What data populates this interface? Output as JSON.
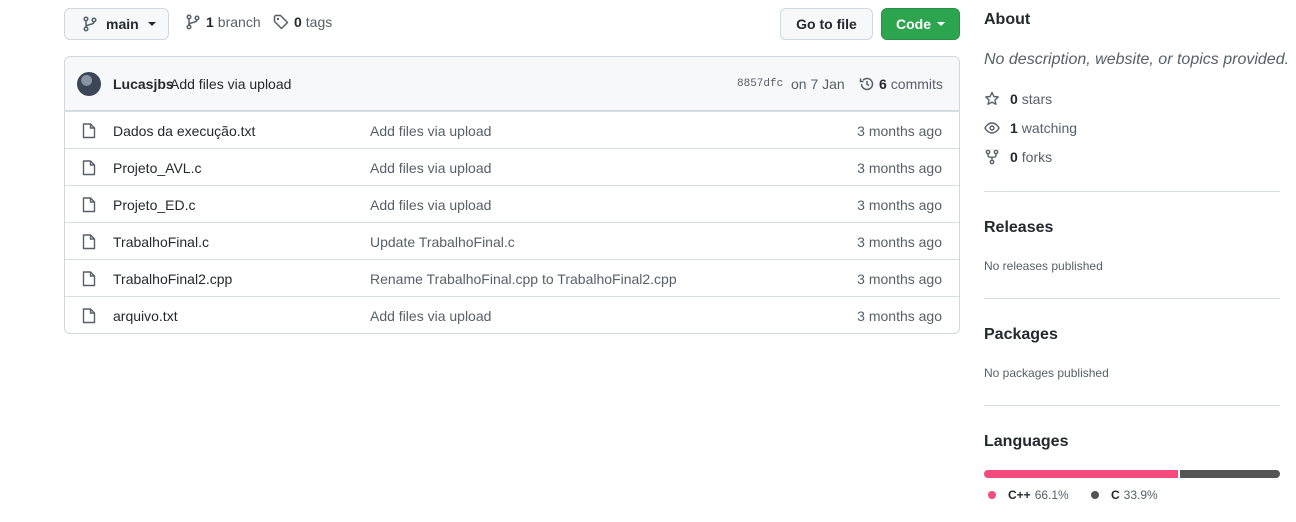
{
  "toolbar": {
    "branch_selector": "main",
    "branches_count": "1",
    "branches_label": "branch",
    "tags_count": "0",
    "tags_label": "tags",
    "go_to_file": "Go to file",
    "code_button": "Code"
  },
  "latest_commit": {
    "author": "Lucasjbs",
    "message": "Add files via upload",
    "sha": "8857dfc",
    "date": "on 7 Jan",
    "commits_count": "6",
    "commits_label": "commits"
  },
  "files": [
    {
      "name": "Dados da execução.txt",
      "message": "Add files via upload",
      "age": "3 months ago"
    },
    {
      "name": "Projeto_AVL.c",
      "message": "Add files via upload",
      "age": "3 months ago"
    },
    {
      "name": "Projeto_ED.c",
      "message": "Add files via upload",
      "age": "3 months ago"
    },
    {
      "name": "TrabalhoFinal.c",
      "message": "Update TrabalhoFinal.c",
      "age": "3 months ago"
    },
    {
      "name": "TrabalhoFinal2.cpp",
      "message": "Rename TrabalhoFinal.cpp to TrabalhoFinal2.cpp",
      "age": "3 months ago"
    },
    {
      "name": "arquivo.txt",
      "message": "Add files via upload",
      "age": "3 months ago"
    }
  ],
  "about": {
    "heading": "About",
    "description": "No description, website, or topics provided.",
    "stars_count": "0",
    "stars_label": "stars",
    "watching_count": "1",
    "watching_label": "watching",
    "forks_count": "0",
    "forks_label": "forks"
  },
  "releases": {
    "heading": "Releases",
    "text": "No releases published"
  },
  "packages": {
    "heading": "Packages",
    "text": "No packages published"
  },
  "languages": {
    "heading": "Languages",
    "items": [
      {
        "name": "C++",
        "percent": "66.1%",
        "value": 66.1,
        "color": "#f34b7d"
      },
      {
        "name": "C",
        "percent": "33.9%",
        "value": 33.9,
        "color": "#555555"
      }
    ]
  },
  "colors": {
    "accent_green": "#2da44e",
    "border": "#d0d7de",
    "muted": "#57606a"
  }
}
